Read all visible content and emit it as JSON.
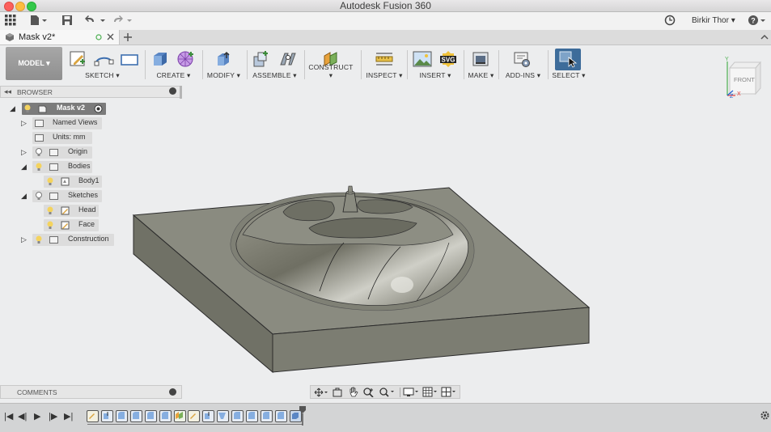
{
  "window": {
    "title": "Autodesk Fusion 360"
  },
  "appbar": {
    "user": "Birkir Thor ▾",
    "help": "?"
  },
  "document_tab": {
    "label": "Mask v2*"
  },
  "workspace": {
    "label": "MODEL ▾"
  },
  "toolbar": {
    "groups": [
      {
        "label": "SKETCH ▾"
      },
      {
        "label": "CREATE ▾"
      },
      {
        "label": "MODIFY ▾"
      },
      {
        "label": "ASSEMBLE ▾"
      },
      {
        "label": "CONSTRUCT ▾"
      },
      {
        "label": "INSPECT ▾"
      },
      {
        "label": "INSERT ▾"
      },
      {
        "label": "MAKE ▾"
      },
      {
        "label": "ADD-INS ▾"
      },
      {
        "label": "SELECT ▾"
      }
    ]
  },
  "browser": {
    "title": "BROWSER",
    "items": [
      {
        "label": "Mask v2"
      },
      {
        "label": "Named Views"
      },
      {
        "label": "Units: mm"
      },
      {
        "label": "Origin"
      },
      {
        "label": "Bodies"
      },
      {
        "label": "Body1"
      },
      {
        "label": "Sketches"
      },
      {
        "label": "Head"
      },
      {
        "label": "Face"
      },
      {
        "label": "Construction"
      }
    ]
  },
  "comments": {
    "title": "COMMENTS"
  },
  "viewcube": {
    "face": "FRONT",
    "axis_x": "X",
    "axis_y": "Y",
    "axis_z": "Z"
  },
  "colors": {
    "model": "#8a8b80",
    "accent": "#3d6c9a",
    "panel": "#ecedee"
  }
}
